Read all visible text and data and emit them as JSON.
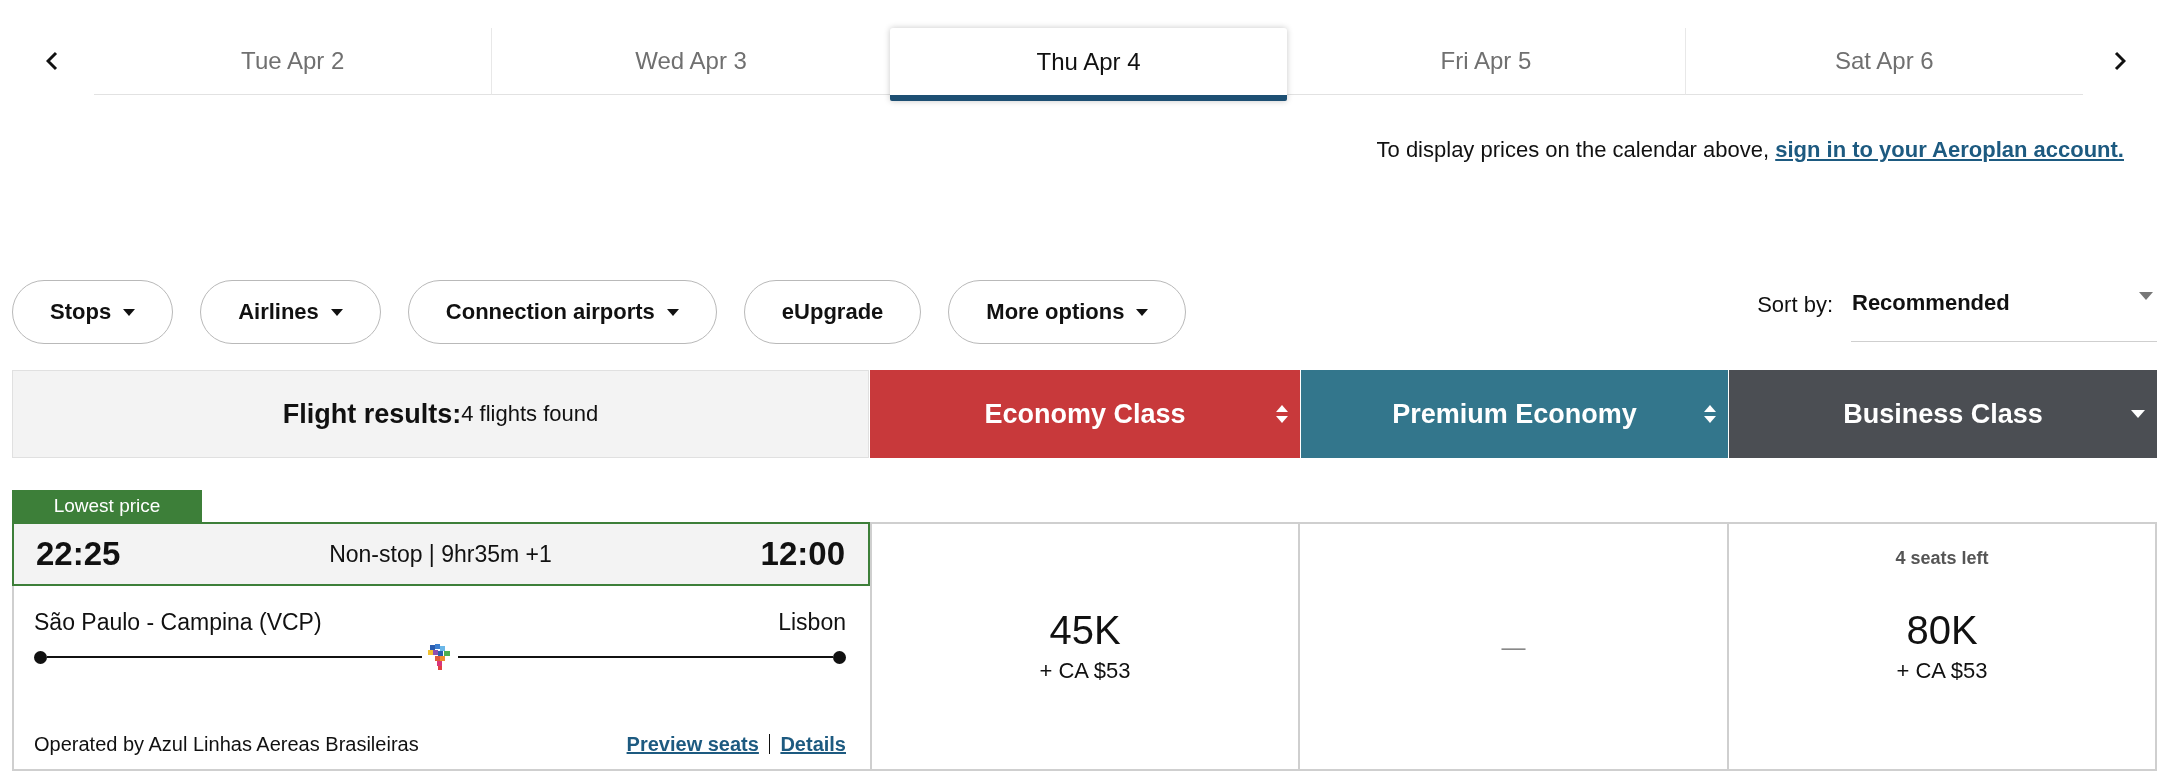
{
  "date_tabs": [
    {
      "label": "Tue Apr 2",
      "selected": false
    },
    {
      "label": "Wed Apr 3",
      "selected": false
    },
    {
      "label": "Thu Apr 4",
      "selected": true
    },
    {
      "label": "Fri Apr 5",
      "selected": false
    },
    {
      "label": "Sat Apr 6",
      "selected": false
    }
  ],
  "sign_in_notice": {
    "text": "To display prices on the calendar above,",
    "link": "sign in to your Aeroplan account."
  },
  "filters": [
    {
      "label": "Stops",
      "kind": "dropdown"
    },
    {
      "label": "Airlines",
      "kind": "dropdown"
    },
    {
      "label": "Connection airports",
      "kind": "dropdown"
    },
    {
      "label": "eUpgrade",
      "kind": "toggle"
    },
    {
      "label": "More options",
      "kind": "dropdown"
    }
  ],
  "sort": {
    "label": "Sort by:",
    "value": "Recommended"
  },
  "results_header": {
    "title": "Flight results:",
    "count": "4 flights found"
  },
  "cabins": [
    {
      "name": "Economy Class",
      "color": "#c8393b",
      "kind": "sortable"
    },
    {
      "name": "Premium Economy",
      "color": "#33768c",
      "kind": "sortable"
    },
    {
      "name": "Business Class",
      "color": "#4b4e53",
      "kind": "menu"
    }
  ],
  "flights": [
    {
      "badge": "Lowest price",
      "depart_time": "22:25",
      "summary": "Non-stop | 9hr35m +1",
      "arrive_time": "12:00",
      "origin": "São Paulo - Campina (VCP)",
      "destination": "Lisbon",
      "operator": "Operated by Azul Linhas Aereas Brasileiras",
      "links": [
        "Preview seats",
        "Details"
      ],
      "fares": [
        {
          "kind": "price",
          "points": "45K",
          "cash": "+ CA $53"
        },
        {
          "kind": "unavailable",
          "text": "—"
        },
        {
          "kind": "price",
          "note": "4 seats left",
          "points": "80K",
          "cash": "+ CA $53"
        }
      ]
    }
  ]
}
